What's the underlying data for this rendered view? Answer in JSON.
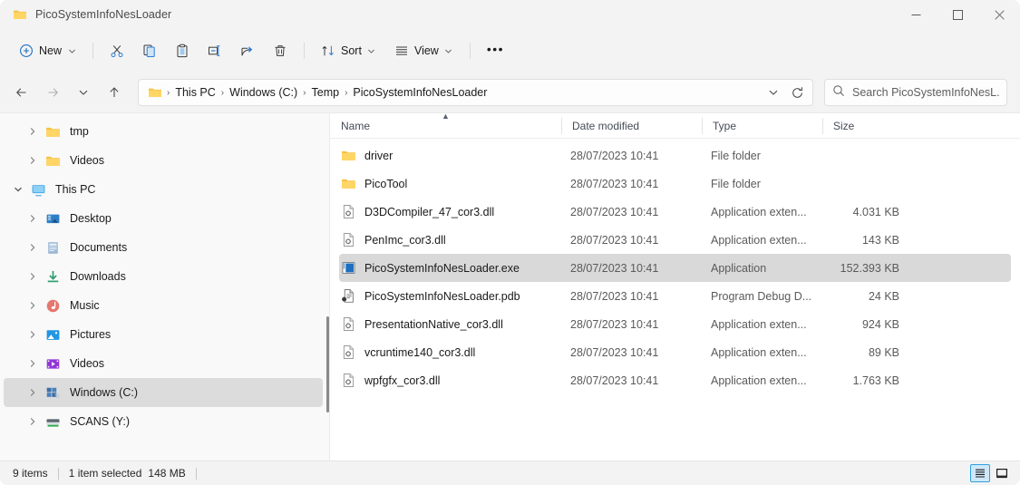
{
  "window": {
    "title": "PicoSystemInfoNesLoader",
    "title_icon": "folder-icon",
    "minimize_label": "–",
    "maximize_label": "□",
    "close_label": "✕"
  },
  "toolbar": {
    "new_label": "New",
    "cut_label": "Cut",
    "copy_label": "Copy",
    "paste_label": "Paste",
    "rename_label": "Rename",
    "share_label": "Share",
    "delete_label": "Delete",
    "sort_label": "Sort",
    "view_label": "View",
    "more_label": "•••"
  },
  "address": {
    "back_label": "Back",
    "forward_label": "Forward",
    "recent_label": "Recent locations",
    "up_label": "Up",
    "refresh_label": "Refresh",
    "dropdown_label": "Previous locations",
    "breadcrumbs": [
      {
        "label": "This PC"
      },
      {
        "label": "Windows (C:)"
      },
      {
        "label": "Temp"
      },
      {
        "label": "PicoSystemInfoNesLoader"
      }
    ],
    "separator": "›"
  },
  "search": {
    "placeholder": "Search PicoSystemInfoNesL...",
    "icon": "search-icon"
  },
  "sidebar": {
    "items": [
      {
        "label": "tmp",
        "icon": "folder-icon",
        "level": 1,
        "expanded": false,
        "selected": false,
        "has_arrow": true
      },
      {
        "label": "Videos",
        "icon": "folder-icon",
        "level": 1,
        "expanded": false,
        "selected": false,
        "has_arrow": true
      },
      {
        "label": "This PC",
        "icon": "this-pc-icon",
        "level": 0,
        "expanded": true,
        "selected": false,
        "has_arrow": true
      },
      {
        "label": "Desktop",
        "icon": "desktop-icon",
        "level": 1,
        "expanded": false,
        "selected": false,
        "has_arrow": true
      },
      {
        "label": "Documents",
        "icon": "documents-icon",
        "level": 1,
        "expanded": false,
        "selected": false,
        "has_arrow": true
      },
      {
        "label": "Downloads",
        "icon": "downloads-icon",
        "level": 1,
        "expanded": false,
        "selected": false,
        "has_arrow": true
      },
      {
        "label": "Music",
        "icon": "music-icon",
        "level": 1,
        "expanded": false,
        "selected": false,
        "has_arrow": true
      },
      {
        "label": "Pictures",
        "icon": "pictures-icon",
        "level": 1,
        "expanded": false,
        "selected": false,
        "has_arrow": true
      },
      {
        "label": "Videos",
        "icon": "videos-icon",
        "level": 1,
        "expanded": false,
        "selected": false,
        "has_arrow": true
      },
      {
        "label": "Windows (C:)",
        "icon": "windows-drive-icon",
        "level": 1,
        "expanded": false,
        "selected": true,
        "has_arrow": true
      },
      {
        "label": "SCANS (Y:)",
        "icon": "network-drive-icon",
        "level": 1,
        "expanded": false,
        "selected": false,
        "has_arrow": true
      }
    ]
  },
  "filelist": {
    "columns": [
      {
        "label": "Name",
        "sorted": true,
        "sort_dir": "asc"
      },
      {
        "label": "Date modified",
        "sorted": false
      },
      {
        "label": "Type",
        "sorted": false
      },
      {
        "label": "Size",
        "sorted": false
      }
    ],
    "rows": [
      {
        "name": "driver",
        "date": "28/07/2023 10:41",
        "type": "File folder",
        "size": "",
        "icon": "folder-icon",
        "selected": false
      },
      {
        "name": "PicoTool",
        "date": "28/07/2023 10:41",
        "type": "File folder",
        "size": "",
        "icon": "folder-icon",
        "selected": false
      },
      {
        "name": "D3DCompiler_47_cor3.dll",
        "date": "28/07/2023 10:41",
        "type": "Application exten...",
        "size": "4.031 KB",
        "icon": "dll-icon",
        "selected": false
      },
      {
        "name": "PenImc_cor3.dll",
        "date": "28/07/2023 10:41",
        "type": "Application exten...",
        "size": "143 KB",
        "icon": "dll-icon",
        "selected": false
      },
      {
        "name": "PicoSystemInfoNesLoader.exe",
        "date": "28/07/2023 10:41",
        "type": "Application",
        "size": "152.393 KB",
        "icon": "exe-icon",
        "selected": true
      },
      {
        "name": "PicoSystemInfoNesLoader.pdb",
        "date": "28/07/2023 10:41",
        "type": "Program Debug D...",
        "size": "24 KB",
        "icon": "pdb-icon",
        "selected": false
      },
      {
        "name": "PresentationNative_cor3.dll",
        "date": "28/07/2023 10:41",
        "type": "Application exten...",
        "size": "924 KB",
        "icon": "dll-icon",
        "selected": false
      },
      {
        "name": "vcruntime140_cor3.dll",
        "date": "28/07/2023 10:41",
        "type": "Application exten...",
        "size": "89 KB",
        "icon": "dll-icon",
        "selected": false
      },
      {
        "name": "wpfgfx_cor3.dll",
        "date": "28/07/2023 10:41",
        "type": "Application exten...",
        "size": "1.763 KB",
        "icon": "dll-icon",
        "selected": false
      }
    ]
  },
  "statusbar": {
    "item_count": "9 items",
    "selection": "1 item selected",
    "selection_size": "148 MB",
    "details_view_label": "Details view",
    "large_icons_view_label": "Large icons view",
    "active_view": "details"
  },
  "colors": {
    "accent": "#0f6cbd",
    "icon_blue": "#2b7cd3",
    "folder_yellow": "#ffc societ"
  }
}
